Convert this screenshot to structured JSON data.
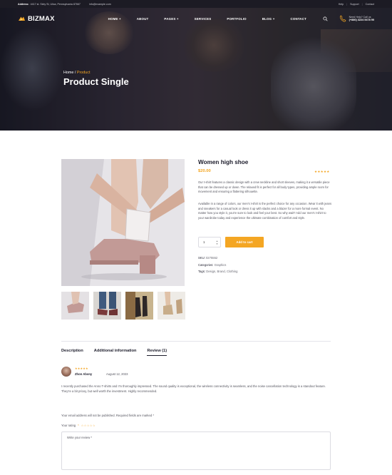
{
  "topbar": {
    "address_label": "Address:",
    "address_value": "4417 st. Sixty St, Ulica, Pennsylvania 87667",
    "email": "info@example.com",
    "links": [
      "Help",
      "Support",
      "Contact"
    ]
  },
  "header": {
    "logo_text": "BIZMAX",
    "menu": [
      "HOME +",
      "ABOUT",
      "PAGES +",
      "SERVICES",
      "PORTFOLIO",
      "BLOG +",
      "CONTACT"
    ],
    "contact_line1": "Need Help? Call us",
    "contact_line2": "(+880) 3224 5478 90"
  },
  "hero": {
    "breadcrumb_home": "Home",
    "breadcrumb_sep": "/",
    "breadcrumb_current": "Product",
    "title": "Product Single"
  },
  "product": {
    "name": "Women high shoe",
    "price": "$20.00",
    "stars": "★★★★★",
    "description_1": "Our t-shirt features a classic design with a crew neckline and short sleeves, making it a versatile piece that can be dressed up or down. The relaxed fit is perfect for all body types, providing ample room for movement and ensuring a flattering silhouette.",
    "description_2": "Available in a range of colors, our men's t-shirt is the perfect choice for any occasion. Wear it with jeans and sneakers for a casual look or dress it up with slacks and a blazer for a more formal event. No matter how you style it, you're sure to look and feel your best. So why wait? Add our men's t-shirt to your wardrobe today and experience the ultimate combination of comfort and style.",
    "quantity": "1",
    "add_to_cart": "Add to cart",
    "sku_label": "SKU:",
    "sku": "0275552",
    "categories_label": "Categories:",
    "categories": "Graphics",
    "tags_label": "Tags:",
    "tags": "Design, Brand, Clothing"
  },
  "tabs": [
    "Description",
    "Additional information",
    "Review (1)"
  ],
  "review": {
    "stars": "★★★★★",
    "author": "Zhon Abony",
    "date": "August 12, 2023",
    "text": "I recently purchased the Anno T-shirts and I'm thoroughly impressed. The sound quality is exceptional, the wireless connectivity is seamless, and the noise cancellation technology is a standout feature. They're a bit pricey, but well worth the investment. Highly recommended."
  },
  "review_form": {
    "note": "Your email address will not be published. Required fields are marked *",
    "rating_label": "Your rating",
    "required_mark": "*",
    "rating_stars": "☆☆☆☆☆",
    "textarea_placeholder": "Write your review *"
  },
  "colors": {
    "accent": "#f4a623",
    "dark": "#1c1b24",
    "text": "#1d1d2c"
  }
}
